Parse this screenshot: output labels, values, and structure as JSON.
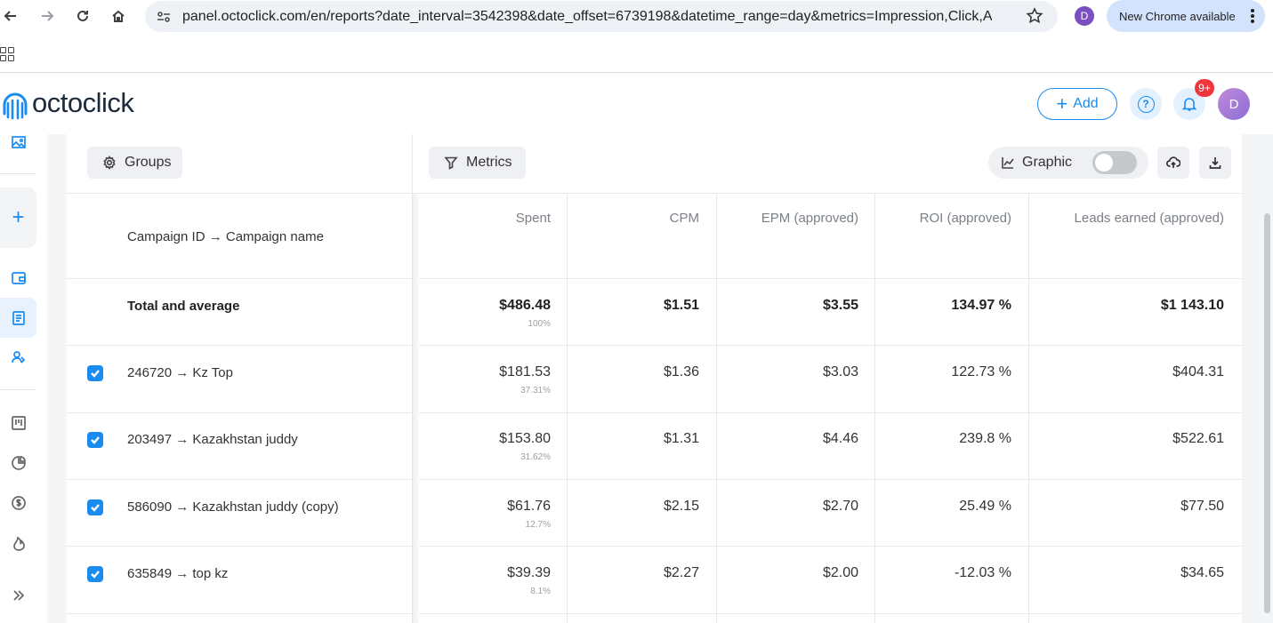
{
  "browser": {
    "url": "panel.octoclick.com/en/reports?date_interval=3542398&date_offset=6739198&datetime_range=day&metrics=Impression,Click,Adv...",
    "profile_initial": "D",
    "update_label": "New Chrome available"
  },
  "header": {
    "logo_text": "octoclick",
    "add_label": "Add",
    "notifications_badge": "9+",
    "help_symbol": "?",
    "avatar_initial": "D"
  },
  "toolbar": {
    "groups_label": "Groups",
    "metrics_label": "Metrics",
    "graphic_label": "Graphic",
    "graphic_enabled": false
  },
  "table": {
    "group_header": "Campaign ID → Campaign name",
    "columns": [
      "Spent",
      "CPM",
      "EPM (approved)",
      "ROI (approved)",
      "Leads earned (approved)"
    ],
    "total": {
      "name": "Total and average",
      "spent": "$486.48",
      "spent_share": "100%",
      "cpm": "$1.51",
      "epm": "$3.55",
      "roi": "134.97 %",
      "leads": "$1 143.10"
    },
    "rows": [
      {
        "name": "246720 → Kz Top",
        "checked": true,
        "spent": "$181.53",
        "spent_share": "37.31%",
        "cpm": "$1.36",
        "epm": "$3.03",
        "roi": "122.73 %",
        "leads": "$404.31"
      },
      {
        "name": "203497 → Kazakhstan juddy",
        "checked": true,
        "spent": "$153.80",
        "spent_share": "31.62%",
        "cpm": "$1.31",
        "epm": "$4.46",
        "roi": "239.8 %",
        "leads": "$522.61"
      },
      {
        "name": "586090 → Kazakhstan juddy (copy)",
        "checked": true,
        "spent": "$61.76",
        "spent_share": "12.7%",
        "cpm": "$2.15",
        "epm": "$2.70",
        "roi": "25.49 %",
        "leads": "$77.50"
      },
      {
        "name": "635849 → top kz",
        "checked": true,
        "spent": "$39.39",
        "spent_share": "8.1%",
        "cpm": "$2.27",
        "epm": "$2.00",
        "roi": "-12.03 %",
        "leads": "$34.65"
      }
    ]
  },
  "colors": {
    "accent": "#1a8cf0",
    "badge": "#f0353d",
    "chrome_update": "#d3e3fd"
  }
}
